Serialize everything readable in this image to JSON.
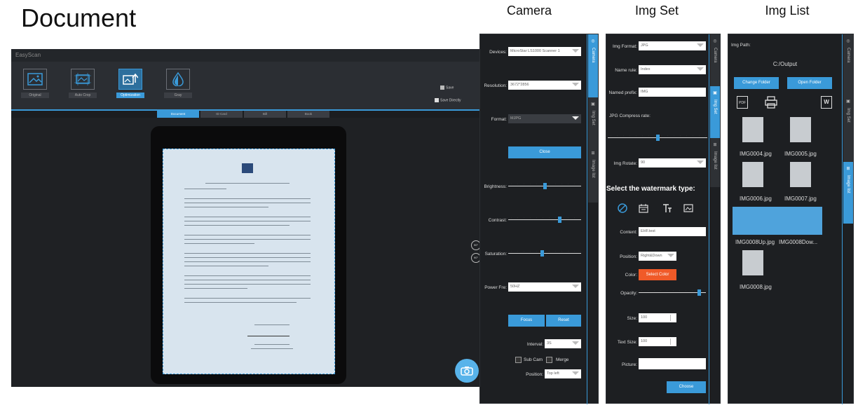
{
  "headings": {
    "document": "Document",
    "camera": "Camera",
    "img_set": "Img Set",
    "img_list": "Img List"
  },
  "main": {
    "app_title": "EasyScan",
    "tools": [
      "Original",
      "Auto Crop",
      "Optimization",
      "Gray"
    ],
    "save_label": "Save",
    "save_directly": "Save Directly",
    "tabs": [
      "Document",
      "ID Card",
      "Bill",
      "Book"
    ],
    "rotate_left": "90°",
    "rotate_right": "90°"
  },
  "camera": {
    "devices_label": "Devices:",
    "devices_value": "MicroStar LS1000 Scanner 1",
    "resolution_label": "Resolution:",
    "resolution_value": "3672*2856",
    "format_label": "Format:",
    "format_value": "MJPG",
    "close_btn": "Close",
    "brightness_label": "Brightness:",
    "contrast_label": "Contrast:",
    "saturation_label": "Saturation:",
    "power_label": "Power Fre:",
    "power_value": "50HZ",
    "focus_btn": "Focus",
    "reset_btn": "Reset",
    "interval_label": "Interval:",
    "interval_value": "3S",
    "subcam_label": "Sub Cam",
    "merge_label": "Merge",
    "position_label": "Position:",
    "position_value": "Top left",
    "brightness": 0.5,
    "contrast": 0.7,
    "saturation": 0.46,
    "tabs": [
      "Camera",
      "Img Set",
      "Image list"
    ]
  },
  "imgset": {
    "format_label": "Img Format:",
    "format_value": "JPG",
    "namerule_label": "Name rule:",
    "namerule_value": "Index",
    "prefix_label": "Named prefix:",
    "prefix_value": "IMG",
    "jpg_label": "JPG Compress rate:",
    "jpg_rate": 0.5,
    "rotate_label": "Img Rotate:",
    "rotate_value": "90",
    "watermark_title": "Select the watermark type:",
    "content_label": "Content:",
    "content_value": "EHF.test",
    "position_label": "Position:",
    "position_value": "Right&Down",
    "color_label": "Color:",
    "color_btn": "Select Color",
    "opacity_label": "Opacity:",
    "opacity": 0.9,
    "size_label": "Size:",
    "size_value": "100",
    "textsize_label": "Text Size:",
    "textsize_value": "100",
    "picture_label": "Picture:",
    "choose_btn": "Choose",
    "tabs": [
      "Camera",
      "Img Set",
      "Image list"
    ]
  },
  "imglist": {
    "path_label": "Img Path:",
    "path_value": "C:/Output",
    "change_btn": "Change Folder",
    "open_btn": "Open Folder",
    "files": [
      "IMG0004.jpg",
      "IMG0005.jpg",
      "IMG0006.jpg",
      "IMG0007.jpg",
      "IMG0008Up.jpg",
      "IMG0008Dow...",
      "IMG0008.jpg"
    ],
    "tabs": [
      "Camera",
      "Img Set",
      "Image list"
    ]
  },
  "colors": {
    "accent": "#3a9ad9",
    "orange": "#f05a28",
    "panel": "#1d1f22"
  }
}
